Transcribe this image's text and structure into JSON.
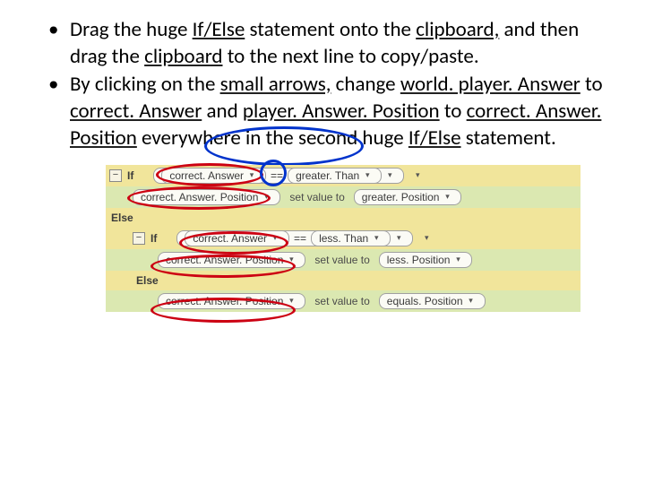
{
  "bullets": [
    {
      "pre": "Drag the huge ",
      "kw1": "If/Else",
      "mid1": " statement onto the ",
      "kw2": "clipboard,",
      "mid2": " and then drag the ",
      "kw3": "clipboard",
      "post": " to the next line to copy/paste."
    },
    {
      "pre": "By clicking on the  ",
      "kw1": "small arrows,",
      "mid1": "  change ",
      "kw2": "world. player. Answer",
      "mid2": " to ",
      "kw3": "correct. Answer",
      "mid3": " and ",
      "kw4": "player. Answer. Position",
      "mid4": " to ",
      "kw5": "correct. Answer. Position",
      "mid5": " everywhere in the second huge ",
      "kw6": "If/Else",
      "post": " statement."
    }
  ],
  "code": {
    "toggle": "−",
    "if": "If",
    "else": "Else",
    "eq": "==",
    "setval": "set value to",
    "row1": {
      "left": "correct. Answer",
      "right": "greater. Than"
    },
    "row2": {
      "left": "correct. Answer. Position",
      "right": "greater. Position"
    },
    "row3": {
      "left": "correct. Answer",
      "right": "less. Than"
    },
    "row4": {
      "left": "correct. Answer. Position",
      "right": "less. Position"
    },
    "row5": {
      "left": "correct. Answer. Position",
      "right": "equals. Position"
    }
  }
}
